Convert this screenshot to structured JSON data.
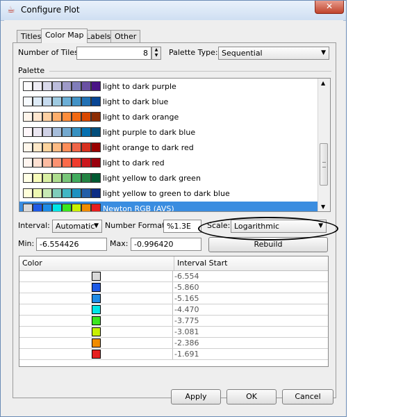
{
  "window": {
    "title": "Configure Plot",
    "close_label": "✕"
  },
  "tabs": [
    {
      "label": "Titles",
      "active": false
    },
    {
      "label": "Color Map",
      "active": true
    },
    {
      "label": "Labels",
      "active": false
    },
    {
      "label": "Other",
      "active": false
    }
  ],
  "tiles": {
    "label": "Number of Tiles:",
    "value": "8"
  },
  "palette_type": {
    "label": "Palette Type:",
    "value": "Sequential"
  },
  "palette": {
    "label": "Palette",
    "items": [
      {
        "name": "light to dark purple",
        "colors": [
          "#fcfbfd",
          "#efedf5",
          "#dadaeb",
          "#bcbddc",
          "#9e9ac8",
          "#807dba",
          "#6a51a3",
          "#4a1486"
        ]
      },
      {
        "name": "light to dark blue",
        "colors": [
          "#f7fbff",
          "#deebf7",
          "#c6dbef",
          "#9ecae1",
          "#6baed6",
          "#4292c6",
          "#2171b5",
          "#084594"
        ]
      },
      {
        "name": "light to dark orange",
        "colors": [
          "#fff5eb",
          "#fee6ce",
          "#fdd0a2",
          "#fdae6b",
          "#fd8d3c",
          "#f16913",
          "#d94801",
          "#8c2d04"
        ]
      },
      {
        "name": "light purple to dark blue",
        "colors": [
          "#fff7fb",
          "#ece7f2",
          "#d0d1e6",
          "#a6bddb",
          "#74a9cf",
          "#3690c0",
          "#0570b0",
          "#034e7b"
        ]
      },
      {
        "name": "light orange to dark red",
        "colors": [
          "#fff7ec",
          "#fee8c8",
          "#fdd49e",
          "#fdbb84",
          "#fc8d59",
          "#ef6548",
          "#d7301f",
          "#990000"
        ]
      },
      {
        "name": "light to dark red",
        "colors": [
          "#fff5f0",
          "#fee0d2",
          "#fcbba1",
          "#fc9272",
          "#fb6a4a",
          "#ef3b2c",
          "#cb181d",
          "#99000d"
        ]
      },
      {
        "name": "light yellow to dark green",
        "colors": [
          "#ffffe5",
          "#f7fcb9",
          "#d9f0a3",
          "#addd8e",
          "#78c679",
          "#41ab5d",
          "#238443",
          "#005a32"
        ]
      },
      {
        "name": "light yellow to green to dark blue",
        "colors": [
          "#ffffd9",
          "#edf8b1",
          "#c7e9b4",
          "#7fcdbb",
          "#41b6c4",
          "#1d91c0",
          "#225ea8",
          "#0c2c84"
        ]
      },
      {
        "name": "Newton RGB (AVS)",
        "colors": [
          "#d9d9d9",
          "#1e5ae6",
          "#1e8ce6",
          "#00e6e6",
          "#3ce61e",
          "#c8f000",
          "#f08c00",
          "#e61e1e"
        ],
        "selected": true
      }
    ]
  },
  "interval": {
    "label": "Interval:",
    "value": "Automatic"
  },
  "number_format": {
    "label": "Number Format:",
    "value": "%1.3E"
  },
  "scale": {
    "label": "Scale:",
    "value": "Logarithmic"
  },
  "min": {
    "label": "Min:",
    "value": "-6.554426"
  },
  "max": {
    "label": "Max:",
    "value": "-0.996420"
  },
  "rebuild_label": "Rebuild",
  "table": {
    "columns": [
      "Color",
      "Interval Start"
    ],
    "rows": [
      {
        "color": "#d9d9d9",
        "value": "-6.554"
      },
      {
        "color": "#1e5ae6",
        "value": "-5.860"
      },
      {
        "color": "#1e8ce6",
        "value": "-5.165"
      },
      {
        "color": "#00e6e6",
        "value": "-4.470"
      },
      {
        "color": "#3ce61e",
        "value": "-3.775"
      },
      {
        "color": "#c8f000",
        "value": "-3.081"
      },
      {
        "color": "#f08c00",
        "value": "-2.386"
      },
      {
        "color": "#e61e1e",
        "value": "-1.691"
      }
    ]
  },
  "buttons": {
    "apply": "Apply",
    "ok": "OK",
    "cancel": "Cancel"
  }
}
